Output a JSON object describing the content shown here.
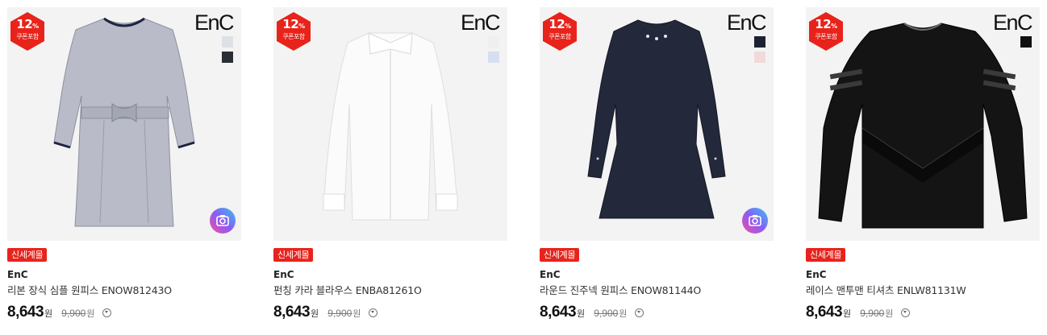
{
  "products": [
    {
      "coupon_percent": "12",
      "coupon_unit": "%",
      "coupon_label": "쿠폰포함",
      "logo": "EnC",
      "swatches": [
        "#dde1e6",
        "#2a2e35"
      ],
      "has_camera_badge": true,
      "image_icon": "dress-icon",
      "tag": "신세계몰",
      "brand": "EnC",
      "name": "리본 장식 심플 원피스 ENOW81243O",
      "price": "8,643",
      "price_unit": "원",
      "original_price": "9,900",
      "original_unit": "원"
    },
    {
      "coupon_percent": "12",
      "coupon_unit": "%",
      "coupon_label": "쿠폰포함",
      "logo": "EnC",
      "swatches": [
        "#efefef",
        "#d7def0"
      ],
      "has_camera_badge": false,
      "image_icon": "blouse-icon",
      "tag": "신세계몰",
      "brand": "EnC",
      "name": "펀칭 카라 블라우스 ENBA81261O",
      "price": "8,643",
      "price_unit": "원",
      "original_price": "9,900",
      "original_unit": "원"
    },
    {
      "coupon_percent": "12",
      "coupon_unit": "%",
      "coupon_label": "쿠폰포함",
      "logo": "EnC",
      "swatches": [
        "#1d2233",
        "#f2dada"
      ],
      "has_camera_badge": true,
      "image_icon": "dress-icon",
      "tag": "신세계몰",
      "brand": "EnC",
      "name": "라운드 진주넥 원피스 ENOW81144O",
      "price": "8,643",
      "price_unit": "원",
      "original_price": "9,900",
      "original_unit": "원"
    },
    {
      "coupon_percent": "12",
      "coupon_unit": "%",
      "coupon_label": "쿠폰포함",
      "logo": "EnC",
      "swatches": [
        "#111111"
      ],
      "has_camera_badge": false,
      "image_icon": "sweatshirt-icon",
      "tag": "신세계몰",
      "brand": "EnC",
      "name": "레이스 맨투맨 티셔츠 ENLW81131W",
      "price": "8,643",
      "price_unit": "원",
      "original_price": "9,900",
      "original_unit": "원"
    }
  ]
}
